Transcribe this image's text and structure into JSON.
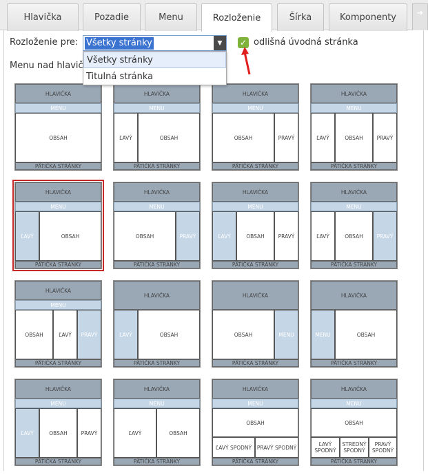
{
  "tabs": [
    {
      "label": "Hlavička",
      "active": false
    },
    {
      "label": "Pozadie",
      "active": false
    },
    {
      "label": "Menu",
      "active": false
    },
    {
      "label": "Rozloženie",
      "active": true
    },
    {
      "label": "Šírka",
      "active": false
    },
    {
      "label": "Komponenty",
      "active": false
    }
  ],
  "toolbar": {
    "layout_for_label": "Rozloženie pre:",
    "selected_value": "Všetky stránky",
    "options": [
      "Všetky stránky",
      "Titulná stránka"
    ],
    "checkbox_checked": true,
    "checkbox_label": "odlišná úvodná stránka",
    "menu_label": "Menu nad hlavičkou"
  },
  "colors": {
    "header": "#9aa8b6",
    "menu": "#c5d6e6",
    "selected_outline": "#c82828",
    "arrow": "#e01e1e",
    "checkbox": "#7fb33a"
  },
  "labels": {
    "header": "HLAVIČKA",
    "menu": "MENU",
    "content": "OBSAH",
    "left": "ĽAVÝ",
    "right": "PRAVÝ",
    "footer": "PÄTIČKA STRÁNKY",
    "left_bottom": "ĽAVÝ SPODNÝ",
    "center_bottom": "STREDNÝ SPODNÝ",
    "right_bottom": "PRAVÝ SPODNÝ"
  },
  "layouts": [
    {
      "id": "h-m-c-f",
      "selected": false
    },
    {
      "id": "h-m-lc-f",
      "selected": false
    },
    {
      "id": "h-m-cr-f",
      "selected": false
    },
    {
      "id": "h-m-lcr-f",
      "selected": false
    },
    {
      "id": "h-m-Lc-f",
      "selected": true
    },
    {
      "id": "h-m-cR-f",
      "selected": false
    },
    {
      "id": "h-m-Lcr-f",
      "selected": false
    },
    {
      "id": "h-m-lcR-f",
      "selected": false
    },
    {
      "id": "h-m-clR-f",
      "selected": false
    },
    {
      "id": "h-Lc",
      "selected": false
    },
    {
      "id": "h-cM",
      "selected": false
    },
    {
      "id": "h-Mc",
      "selected": false
    },
    {
      "id": "h-m-Lcr-f-2",
      "selected": false
    },
    {
      "id": "h-m-lc-f-2",
      "selected": false
    },
    {
      "id": "h-m-c-2b-f",
      "selected": false
    },
    {
      "id": "h-m-c-3b-f",
      "selected": false
    }
  ]
}
